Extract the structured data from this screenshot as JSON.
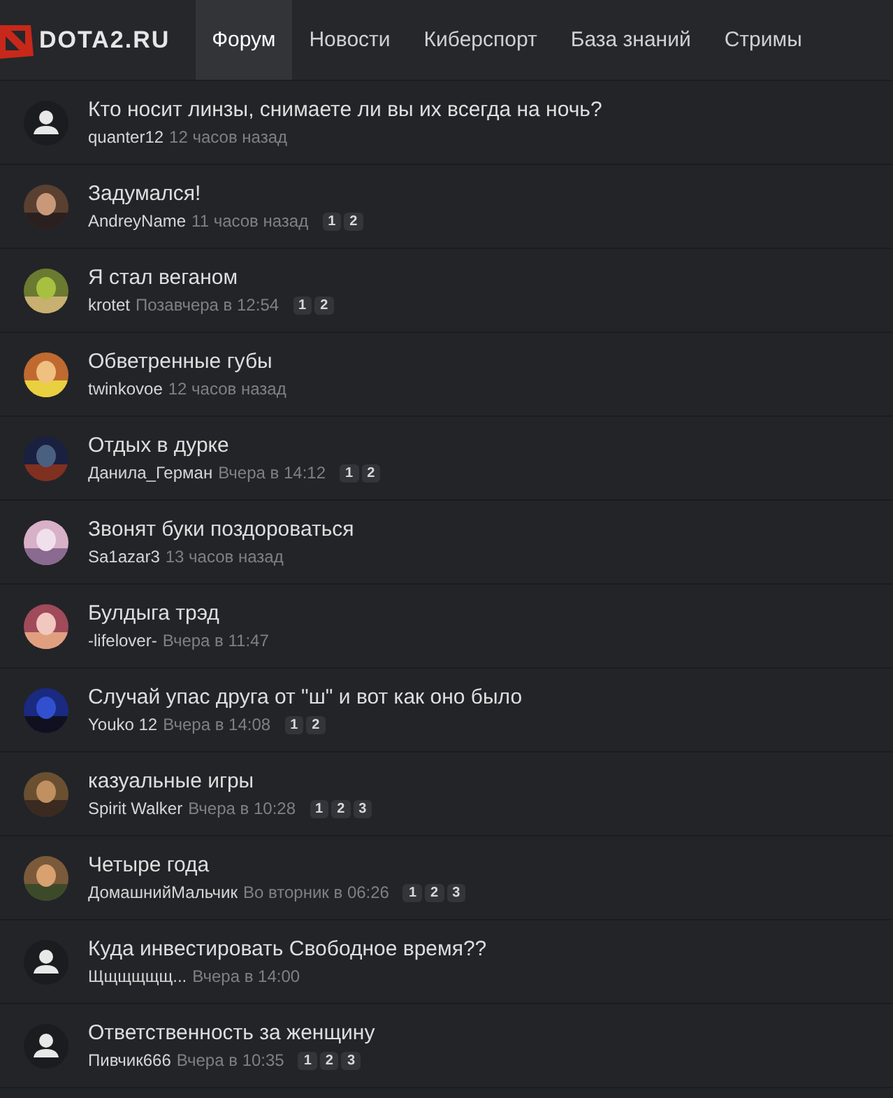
{
  "header": {
    "logo": "DOTA2.RU",
    "tabs": [
      {
        "label": "Форум",
        "selected": true
      },
      {
        "label": "Новости",
        "selected": false
      },
      {
        "label": "Киберспорт",
        "selected": false
      },
      {
        "label": "База знаний",
        "selected": false
      },
      {
        "label": "Стримы",
        "selected": false
      }
    ]
  },
  "topics": [
    {
      "title": "Кто носит линзы, снимаете ли вы их всегда на ночь?",
      "author": "quanter12",
      "time": "12 часов назад",
      "avatar": {
        "kind": "default"
      }
    },
    {
      "title": "Задумался!",
      "author": "AndreyName",
      "time": "11 часов назад",
      "avatar": {
        "kind": "picture"
      },
      "pages": [
        "1",
        "2"
      ]
    },
    {
      "title": "Я стал веганом",
      "author": "krotet",
      "time": "Позавчера в 12:54",
      "avatar": {
        "kind": "picture"
      },
      "pages": [
        "1",
        "2"
      ]
    },
    {
      "title": "Обветренные губы",
      "author": "twinkovoe",
      "time": "12 часов назад",
      "avatar": {
        "kind": "picture"
      }
    },
    {
      "title": "Отдых в дурке",
      "author": "Данила_Герман",
      "time": "Вчера в 14:12",
      "avatar": {
        "kind": "picture"
      },
      "pages": [
        "1",
        "2"
      ]
    },
    {
      "title": "Звонят буки поздороваться",
      "author": "Sa1azar3",
      "time": "13 часов назад",
      "avatar": {
        "kind": "picture"
      }
    },
    {
      "title": "Булдыга трэд",
      "author": "-lifelover-",
      "time": "Вчера в 11:47",
      "avatar": {
        "kind": "picture"
      }
    },
    {
      "title": "Случай упас друга от \"ш\" и вот как оно было",
      "author": "Youko 12",
      "time": "Вчера в 14:08",
      "avatar": {
        "kind": "picture"
      },
      "pages": [
        "1",
        "2"
      ]
    },
    {
      "title": "казуальные игры",
      "author": "Spirit Walker",
      "time": "Вчера в 10:28",
      "avatar": {
        "kind": "picture"
      },
      "pages": [
        "1",
        "2",
        "3"
      ]
    },
    {
      "title": "Четыре года",
      "author": "ДомашнийМальчик",
      "time": "Во вторник в 06:26",
      "avatar": {
        "kind": "picture"
      },
      "pages": [
        "1",
        "2",
        "3"
      ]
    },
    {
      "title": "Куда инвестировать Свободное время??",
      "author": "Щщщщщщ...",
      "time": "Вчера в 14:00",
      "avatar": {
        "kind": "default"
      }
    },
    {
      "title": "Ответственность за женщину",
      "author": "Пивчик666",
      "time": "Вчера в 10:35",
      "avatar": {
        "kind": "default"
      },
      "pages": [
        "1",
        "2",
        "3"
      ]
    }
  ]
}
